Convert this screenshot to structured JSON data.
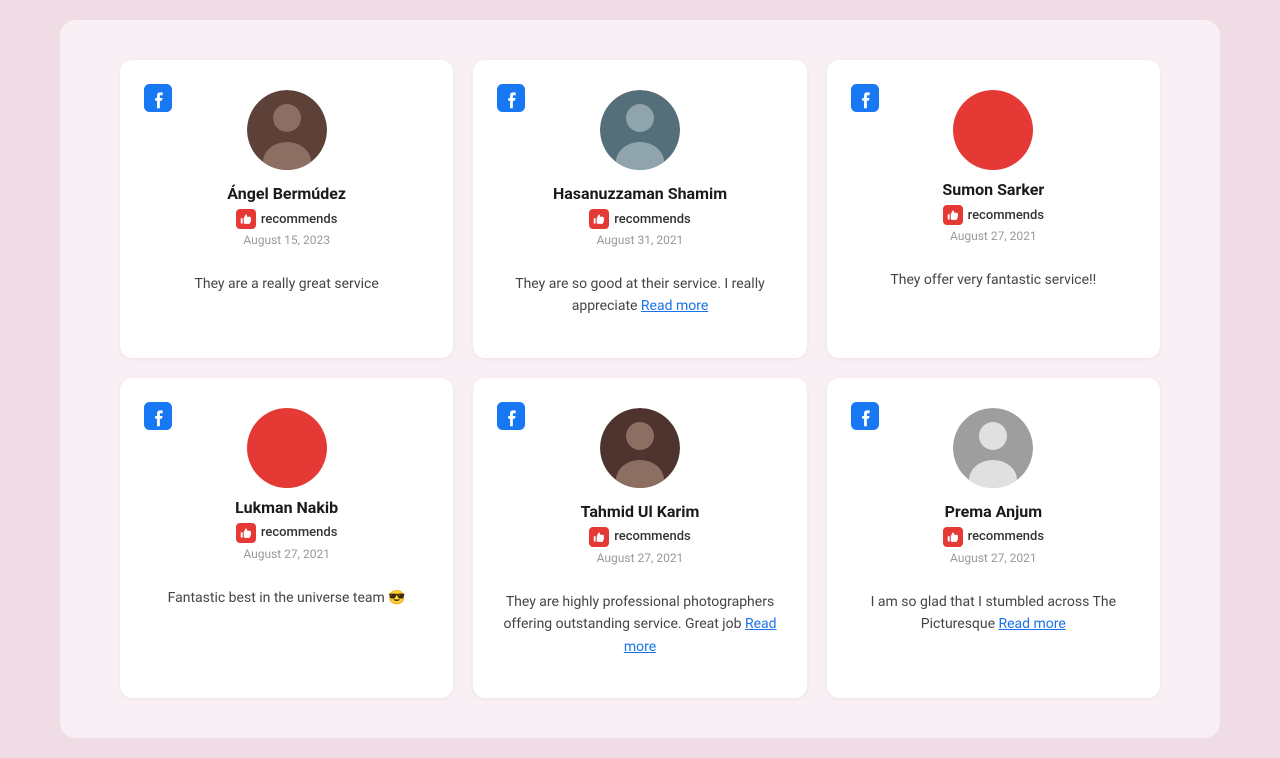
{
  "cards": [
    {
      "id": "angel",
      "name": "Ángel Bermúdez",
      "recommends": "recommends",
      "date": "August 15, 2023",
      "review": "They are a really great service",
      "has_read_more": false,
      "avatar_type": "image",
      "avatar_color": null
    },
    {
      "id": "hasanuzzaman",
      "name": "Hasanuzzaman Shamim",
      "recommends": "recommends",
      "date": "August 31, 2021",
      "review": "They are so good at their service. I really appreciate ",
      "read_more_label": "Read more",
      "has_read_more": true,
      "avatar_type": "image",
      "avatar_color": null
    },
    {
      "id": "sumon",
      "name": "Sumon Sarker",
      "recommends": "recommends",
      "date": "August 27, 2021",
      "review": "They offer very fantastic service!!",
      "has_read_more": false,
      "avatar_type": "circle",
      "avatar_color": "#e53935"
    },
    {
      "id": "lukman",
      "name": "Lukman Nakib",
      "recommends": "recommends",
      "date": "August 27, 2021",
      "review": "Fantastic best in the universe team 😎",
      "has_read_more": false,
      "avatar_type": "circle",
      "avatar_color": "#e53935"
    },
    {
      "id": "tahmid",
      "name": "Tahmid Ul Karim",
      "recommends": "recommends",
      "date": "August 27, 2021",
      "review": "They are highly professional photographers offering outstanding service. Great job ",
      "read_more_label": "Read more",
      "has_read_more": true,
      "avatar_type": "image",
      "avatar_color": null
    },
    {
      "id": "prema",
      "name": "Prema Anjum",
      "recommends": "recommends",
      "date": "August 27, 2021",
      "review": "I am so glad that I stumbled across The Picturesque ",
      "read_more_label": "Read more",
      "has_read_more": true,
      "avatar_type": "image",
      "avatar_color": null
    }
  ],
  "avatar_svgs": {
    "angel": "data:image/svg+xml,%3Csvg xmlns='http://www.w3.org/2000/svg' viewBox='0 0 80 80'%3E%3Ccircle cx='40' cy='40' r='40' fill='%23888'/%3E%3Ccircle cx='40' cy='30' r='14' fill='%23bbb'/%3E%3Cellipse cx='40' cy='70' rx='22' ry='18' fill='%23bbb'/%3E%3C/svg%3E",
    "hasanuzzaman": "data:image/svg+xml,%3Csvg xmlns='http://www.w3.org/2000/svg' viewBox='0 0 80 80'%3E%3Ccircle cx='40' cy='40' r='40' fill='%23aaa'/%3E%3Ccircle cx='40' cy='30' r='14' fill='%23ccc'/%3E%3Cellipse cx='40' cy='70' rx='22' ry='18' fill='%23ccc'/%3E%3C/svg%3E",
    "tahmid": "data:image/svg+xml,%3Csvg xmlns='http://www.w3.org/2000/svg' viewBox='0 0 80 80'%3E%3Ccircle cx='40' cy='40' r='40' fill='%23795548'/%3E%3Ccircle cx='40' cy='30' r='14' fill='%23a1887f'/%3E%3Cellipse cx='40' cy='70' rx='22' ry='18' fill='%23a1887f'/%3E%3C/svg%3E",
    "prema": "data:image/svg+xml,%3Csvg xmlns='http://www.w3.org/2000/svg' viewBox='0 0 80 80'%3E%3Ccircle cx='40' cy='40' r='40' fill='%23bdbdbd'/%3E%3Ccircle cx='40' cy='30' r='14' fill='%23e0e0e0'/%3E%3Cellipse cx='40' cy='70' rx='22' ry='18' fill='%23e0e0e0'/%3E%3C/svg%3E"
  }
}
